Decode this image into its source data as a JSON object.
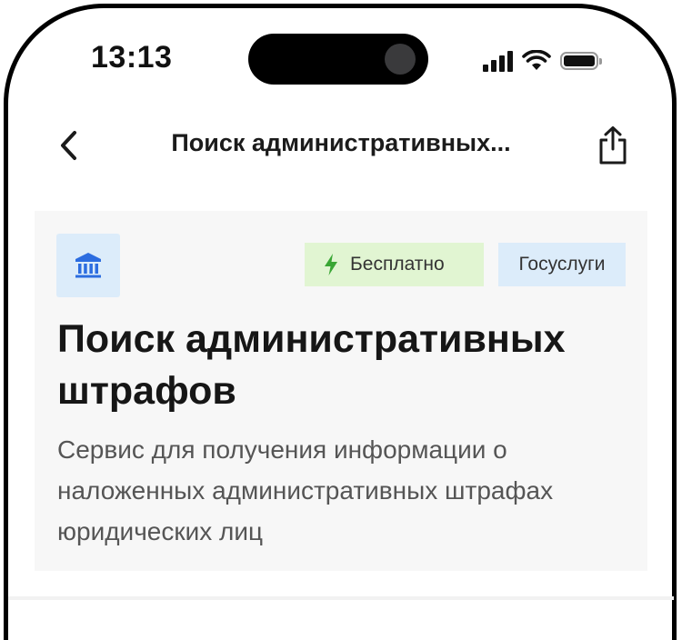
{
  "status_bar": {
    "time": "13:13"
  },
  "nav": {
    "title": "Поиск административных...",
    "back_icon": "chevron-left-icon",
    "share_icon": "share-icon"
  },
  "card": {
    "icon": "government-building-icon",
    "badges": {
      "free": "Бесплатно",
      "gosuslugi": "Госуслуги"
    },
    "title": "Поиск административных штрафов",
    "description": "Сервис для получения информации о наложенных административных штрафах юридических лиц"
  },
  "colors": {
    "card_bg": "#f7f7f7",
    "free_badge_bg": "#e1f5d2",
    "free_icon": "#3aa635",
    "gos_badge_bg": "#dcecfa",
    "org_icon": "#2c6de0"
  }
}
